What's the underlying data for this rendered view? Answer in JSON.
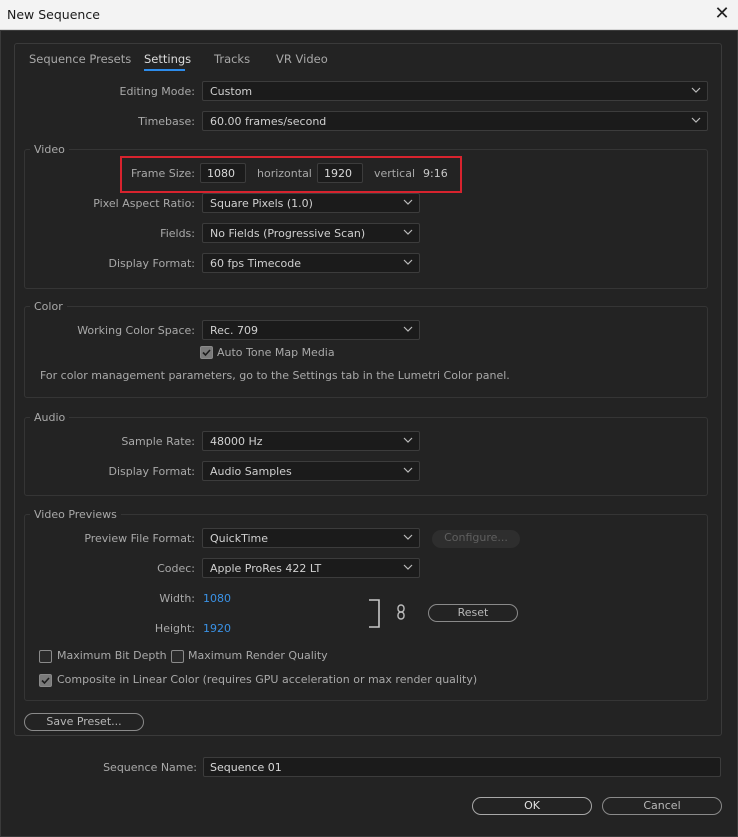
{
  "window": {
    "title": "New Sequence",
    "close_icon": "close-icon"
  },
  "tabs": [
    "Sequence Presets",
    "Settings",
    "Tracks",
    "VR Video"
  ],
  "active_tab": "Settings",
  "top": {
    "editing_mode_label": "Editing Mode:",
    "editing_mode_value": "Custom",
    "timebase_label": "Timebase:",
    "timebase_value": "60.00  frames/second"
  },
  "video": {
    "title": "Video",
    "frame_size_label": "Frame Size:",
    "horizontal_value": "1080",
    "horizontal_label": "horizontal",
    "vertical_value": "1920",
    "vertical_label": "vertical",
    "aspect": "9:16",
    "pixel_aspect_label": "Pixel Aspect Ratio:",
    "pixel_aspect_value": "Square Pixels (1.0)",
    "fields_label": "Fields:",
    "fields_value": "No Fields (Progressive Scan)",
    "display_format_label": "Display Format:",
    "display_format_value": "60 fps Timecode"
  },
  "color": {
    "title": "Color",
    "working_space_label": "Working Color Space:",
    "working_space_value": "Rec. 709",
    "auto_tone_label": "Auto Tone Map Media",
    "auto_tone_checked": true,
    "note": "For color management parameters, go to the Settings tab in the Lumetri Color panel."
  },
  "audio": {
    "title": "Audio",
    "sample_rate_label": "Sample Rate:",
    "sample_rate_value": "48000 Hz",
    "display_format_label": "Display Format:",
    "display_format_value": "Audio Samples"
  },
  "previews": {
    "title": "Video Previews",
    "file_format_label": "Preview File Format:",
    "file_format_value": "QuickTime",
    "configure_label": "Configure...",
    "codec_label": "Codec:",
    "codec_value": "Apple ProRes 422 LT",
    "width_label": "Width:",
    "width_value": "1080",
    "height_label": "Height:",
    "height_value": "1920",
    "reset_label": "Reset",
    "max_bit_depth_label": "Maximum Bit Depth",
    "max_bit_depth_checked": false,
    "max_render_quality_label": "Maximum Render Quality",
    "max_render_quality_checked": false,
    "composite_linear_label": "Composite in Linear Color (requires GPU acceleration or max render quality)",
    "composite_linear_checked": true
  },
  "footer": {
    "save_preset_label": "Save Preset...",
    "sequence_name_label": "Sequence Name:",
    "sequence_name_value": "Sequence 01",
    "ok_label": "OK",
    "cancel_label": "Cancel"
  },
  "colors": {
    "accent": "#2d8ceb",
    "highlight": "#d7232e",
    "link_value": "#3a92e6"
  }
}
